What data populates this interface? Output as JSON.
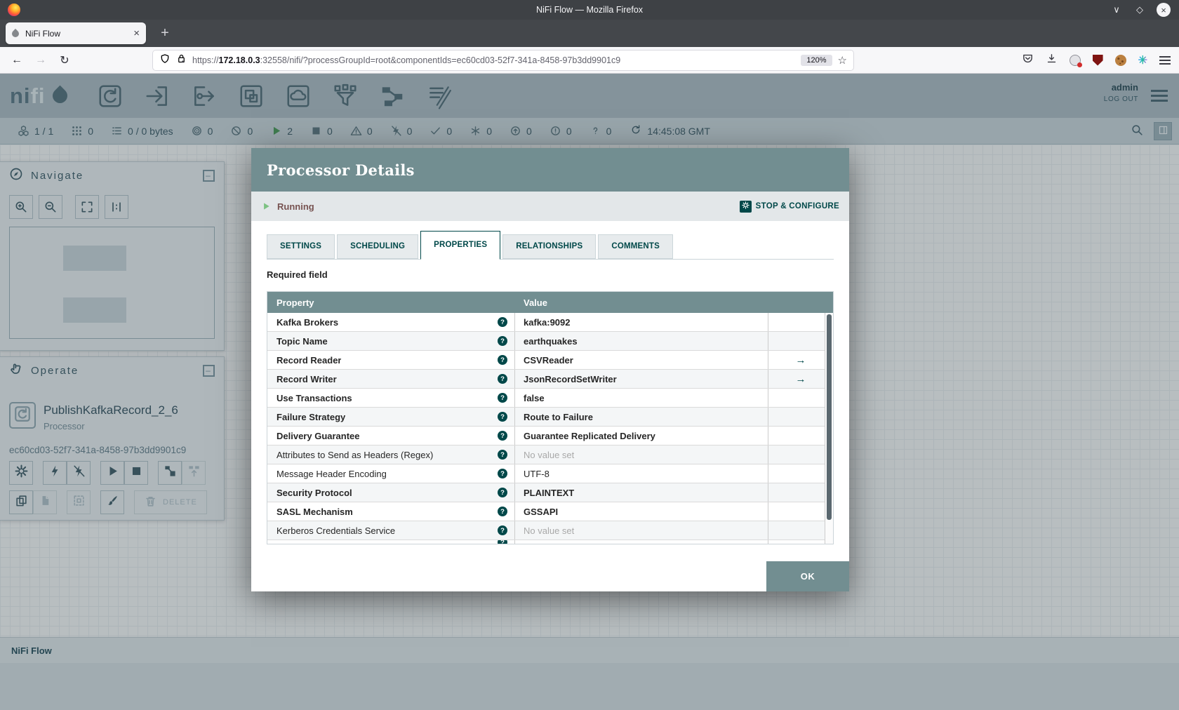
{
  "browser": {
    "window_title": "NiFi Flow — Mozilla Firefox",
    "tab_label": "NiFi Flow",
    "url_scheme": "https://",
    "url_host": "172.18.0.3",
    "url_rest": ":32558/nifi/?processGroupId=root&componentIds=ec60cd03-52f7-341a-8458-97b3dd9901c9",
    "zoom_level": "120%"
  },
  "icons": {
    "close": "×",
    "new_tab": "+",
    "chevron_down": "∨",
    "restore": "◇",
    "back": "←",
    "forward": "→",
    "reload": "↻",
    "star": "☆",
    "minus": "–",
    "help": "?",
    "arrow_right": "→"
  },
  "nifi": {
    "header": {
      "logo_part1": "ni",
      "logo_part2": "fi",
      "components": [
        "processor",
        "input-port",
        "output-port",
        "process-group",
        "remote-process-group",
        "funnel",
        "template",
        "label"
      ],
      "user": "admin",
      "logout_label": "LOG OUT"
    },
    "status_bar": {
      "items": [
        {
          "name": "clustered",
          "icon": "cubes-icon",
          "count": "1 / 1"
        },
        {
          "name": "active-threads",
          "icon": "grid-icon",
          "count": "0"
        },
        {
          "name": "queued",
          "icon": "list-icon",
          "count": "0 / 0 bytes"
        },
        {
          "name": "transmitting",
          "icon": "bullseye-icon",
          "count": "0"
        },
        {
          "name": "not-transmitting",
          "icon": "slash-circle-icon",
          "count": "0"
        },
        {
          "name": "running",
          "icon": "play-icon",
          "count": "2"
        },
        {
          "name": "stopped",
          "icon": "stop-icon",
          "count": "0"
        },
        {
          "name": "invalid",
          "icon": "warning-icon",
          "count": "0"
        },
        {
          "name": "disabled",
          "icon": "lightning-slash-icon",
          "count": "0"
        },
        {
          "name": "up-to-date",
          "icon": "check-icon",
          "count": "0"
        },
        {
          "name": "locally-modified",
          "icon": "asterisk-icon",
          "count": "0"
        },
        {
          "name": "stale",
          "icon": "circle-up-icon",
          "count": "0"
        },
        {
          "name": "locally-modified-stale",
          "icon": "circle-exclamation-icon",
          "count": "0"
        },
        {
          "name": "sync-failure",
          "icon": "question-icon",
          "count": "0"
        }
      ],
      "time": "14:45:08 GMT"
    },
    "navigate": {
      "title": "Navigate",
      "buttons": [
        {
          "name": "zoom-in"
        },
        {
          "name": "zoom-out"
        },
        {
          "name": "zoom-fit"
        },
        {
          "name": "zoom-actual"
        }
      ]
    },
    "operate": {
      "title": "Operate",
      "component_name": "PublishKafkaRecord_2_6",
      "component_type": "Processor",
      "component_id": "ec60cd03-52f7-341a-8458-97b3dd9901c9",
      "buttons_row1": [
        {
          "name": "configure",
          "icon": "gear-icon",
          "enabled": true
        },
        {
          "name": "enable",
          "icon": "lightning-icon",
          "enabled": true
        },
        {
          "name": "disable",
          "icon": "lightning-slash-icon",
          "enabled": true
        },
        {
          "name": "start",
          "icon": "play-icon",
          "enabled": true
        },
        {
          "name": "stop",
          "icon": "stop-icon",
          "enabled": true
        },
        {
          "name": "create-template",
          "icon": "save-template-icon",
          "enabled": true
        },
        {
          "name": "upload-template",
          "icon": "upload-template-icon",
          "enabled": false
        }
      ],
      "buttons_row2": [
        {
          "name": "copy",
          "icon": "copy-icon",
          "enabled": true
        },
        {
          "name": "paste",
          "icon": "paste-icon",
          "enabled": false
        },
        {
          "name": "create-group",
          "icon": "group-icon",
          "enabled": false
        },
        {
          "name": "change-color",
          "icon": "brush-icon",
          "enabled": true
        },
        {
          "name": "delete",
          "icon": "trash-icon",
          "enabled": false,
          "label": "DELETE"
        }
      ]
    },
    "breadcrumb": {
      "label": "NiFi Flow"
    }
  },
  "dialog": {
    "title": "Processor Details",
    "status": {
      "state": "Running",
      "action": "STOP & CONFIGURE"
    },
    "tabs": [
      {
        "label": "SETTINGS",
        "active": false
      },
      {
        "label": "SCHEDULING",
        "active": false
      },
      {
        "label": "PROPERTIES",
        "active": true
      },
      {
        "label": "RELATIONSHIPS",
        "active": false
      },
      {
        "label": "COMMENTS",
        "active": false
      }
    ],
    "required_note": "Required field",
    "table": {
      "columns": [
        "Property",
        "Value"
      ],
      "rows": [
        {
          "property": "Kafka Brokers",
          "value": "kafka:9092",
          "required": true
        },
        {
          "property": "Topic Name",
          "value": "earthquakes",
          "required": true
        },
        {
          "property": "Record Reader",
          "value": "CSVReader",
          "required": true,
          "link": true
        },
        {
          "property": "Record Writer",
          "value": "JsonRecordSetWriter",
          "required": true,
          "link": true
        },
        {
          "property": "Use Transactions",
          "value": "false",
          "required": true
        },
        {
          "property": "Failure Strategy",
          "value": "Route to Failure",
          "required": true
        },
        {
          "property": "Delivery Guarantee",
          "value": "Guarantee Replicated Delivery",
          "required": true
        },
        {
          "property": "Attributes to Send as Headers (Regex)",
          "value": "No value set",
          "required": false,
          "no_value": true
        },
        {
          "property": "Message Header Encoding",
          "value": "UTF-8",
          "required": false
        },
        {
          "property": "Security Protocol",
          "value": "PLAINTEXT",
          "required": true
        },
        {
          "property": "SASL Mechanism",
          "value": "GSSAPI",
          "required": true
        },
        {
          "property": "Kerberos Credentials Service",
          "value": "No value set",
          "required": false,
          "no_value": true
        },
        {
          "partial": true
        }
      ]
    },
    "ok_label": "OK"
  },
  "colors": {
    "accent": "#004849",
    "dialog_header": "#728e91",
    "running_green": "#7dc283",
    "run_state_text": "#775351",
    "no_value_text": "#a9a9a9"
  }
}
